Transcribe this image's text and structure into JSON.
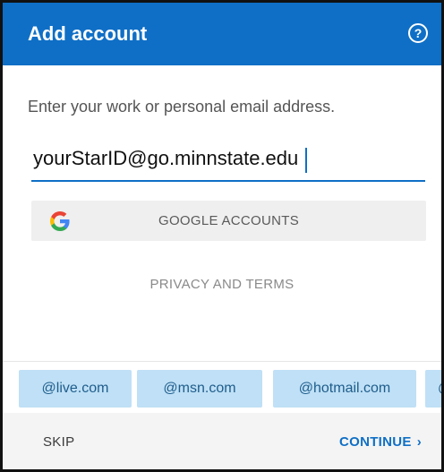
{
  "header": {
    "title": "Add account",
    "help_icon": "question-circle-icon"
  },
  "form": {
    "prompt": "Enter your work or personal email address.",
    "email_value": "yourStarID@go.minnstate.edu"
  },
  "google": {
    "label": "GOOGLE ACCOUNTS",
    "icon": "google-logo-icon"
  },
  "privacy_label": "PRIVACY AND TERMS",
  "domain_suggestions": [
    "@live.com",
    "@msn.com",
    "@hotmail.com",
    "@"
  ],
  "footer": {
    "skip_label": "SKIP",
    "continue_label": "CONTINUE",
    "continue_icon": "chevron-right-icon"
  },
  "colors": {
    "accent": "#0f6fc6",
    "chip_bg": "#bfe0f6",
    "chip_text": "#1f5d8c"
  }
}
